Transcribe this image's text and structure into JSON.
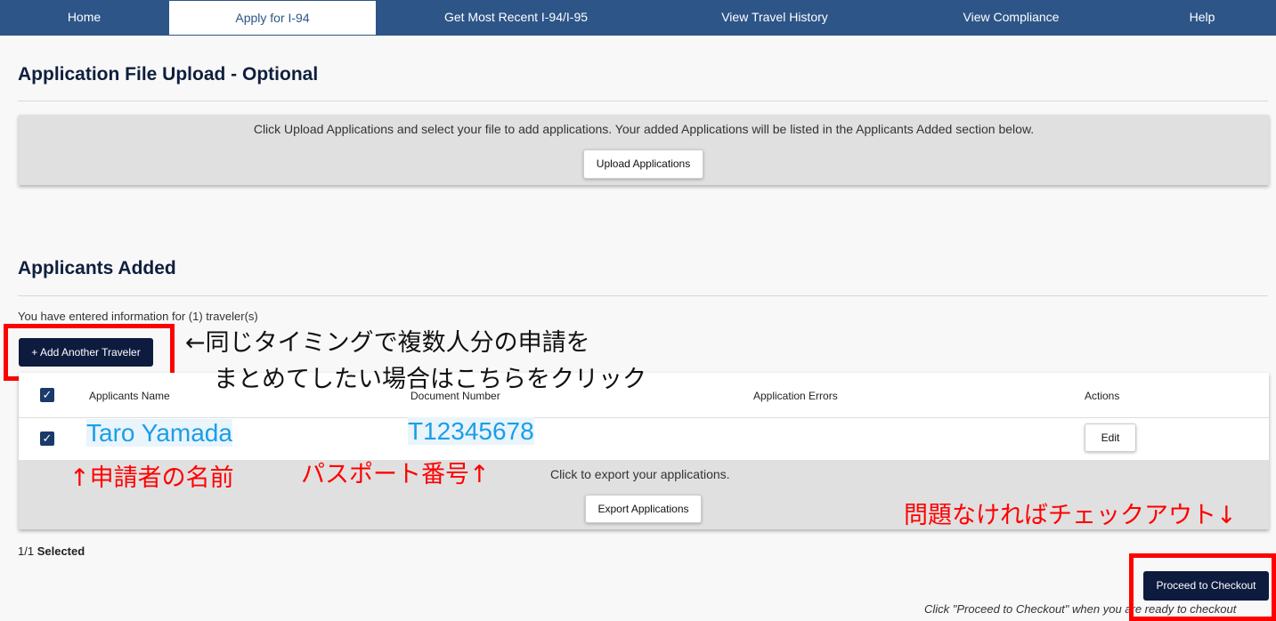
{
  "nav": {
    "home": "Home",
    "apply": "Apply for I-94",
    "recent": "Get Most Recent I-94/I-95",
    "history": "View Travel History",
    "compliance": "View Compliance",
    "help": "Help"
  },
  "upload_section": {
    "title": "Application File Upload - Optional",
    "instructions": "Click Upload Applications and select your file to add applications. Your added Applications will be listed in the Applicants Added section below.",
    "upload_button": "Upload Applications"
  },
  "applicants_section": {
    "title": "Applicants Added",
    "entered_info": "You have entered information for (1) traveler(s)",
    "add_button": "+ Add Another Traveler",
    "columns": {
      "name": "Applicants Name",
      "document": "Document Number",
      "errors": "Application Errors",
      "actions": "Actions"
    },
    "rows": [
      {
        "name": "Taro Yamada",
        "document": "T12345678",
        "errors": "",
        "action": "Edit"
      }
    ],
    "export_text": "Click to export your applications.",
    "export_button": "Export Applications",
    "selected_prefix": "1/1",
    "selected_label": "Selected"
  },
  "checkout": {
    "button": "Proceed to Checkout",
    "hint": "Click \"Proceed to Checkout\" when you are ready to checkout"
  },
  "annotations": {
    "add_traveler_line1": "←同じタイミングで複数人分の申請を",
    "add_traveler_line2": "まとめてしたい場合はこちらをクリック",
    "name_note": "↑申請者の名前",
    "passport_note": "パスポート番号↑",
    "checkout_note": "問題なければチェックアウト↓"
  },
  "colors": {
    "nav_bg": "#2d5587",
    "dark_button": "#0d1b3e",
    "annotation_red": "#ff0000",
    "entry_blue": "#1a9ee8"
  }
}
